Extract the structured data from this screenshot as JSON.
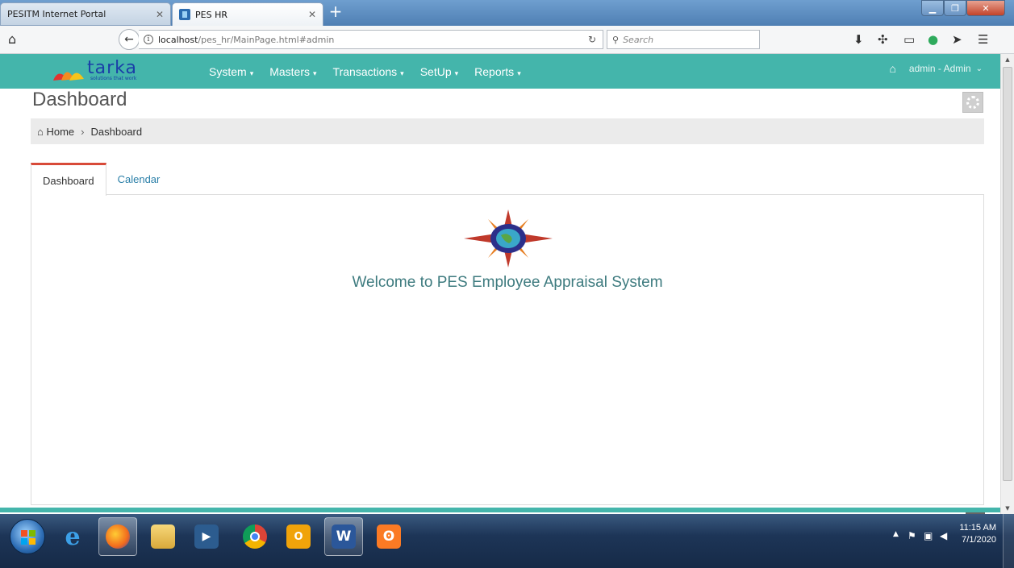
{
  "browser": {
    "tabs": [
      {
        "title": "PESITM Internet Portal",
        "active": false
      },
      {
        "title": "PES HR",
        "active": true
      }
    ],
    "new_tab_symbol": "+",
    "url_host": "localhost",
    "url_path": "/pes_hr/MainPage.html#admin",
    "search_placeholder": "Search"
  },
  "app": {
    "logo_text": "tarka",
    "logo_tagline": "solutions that work",
    "menu": [
      {
        "label": "System"
      },
      {
        "label": "Masters"
      },
      {
        "label": "Transactions"
      },
      {
        "label": "SetUp"
      },
      {
        "label": "Reports"
      }
    ],
    "user_label": "admin - Admin",
    "accent_color": "#44b5ab"
  },
  "page": {
    "title": "Dashboard",
    "breadcrumb": {
      "home": "Home",
      "current": "Dashboard"
    },
    "tabs": [
      {
        "label": "Dashboard",
        "active": true
      },
      {
        "label": "Calendar",
        "active": false
      }
    ],
    "welcome_text": "Welcome to PES Employee Appraisal System"
  },
  "taskbar": {
    "apps": [
      "windows-start",
      "internet-explorer",
      "firefox",
      "file-explorer",
      "media-player",
      "chrome",
      "outlook",
      "word",
      "xampp"
    ],
    "clock_time": "11:15 AM",
    "clock_date": "7/1/2020"
  }
}
